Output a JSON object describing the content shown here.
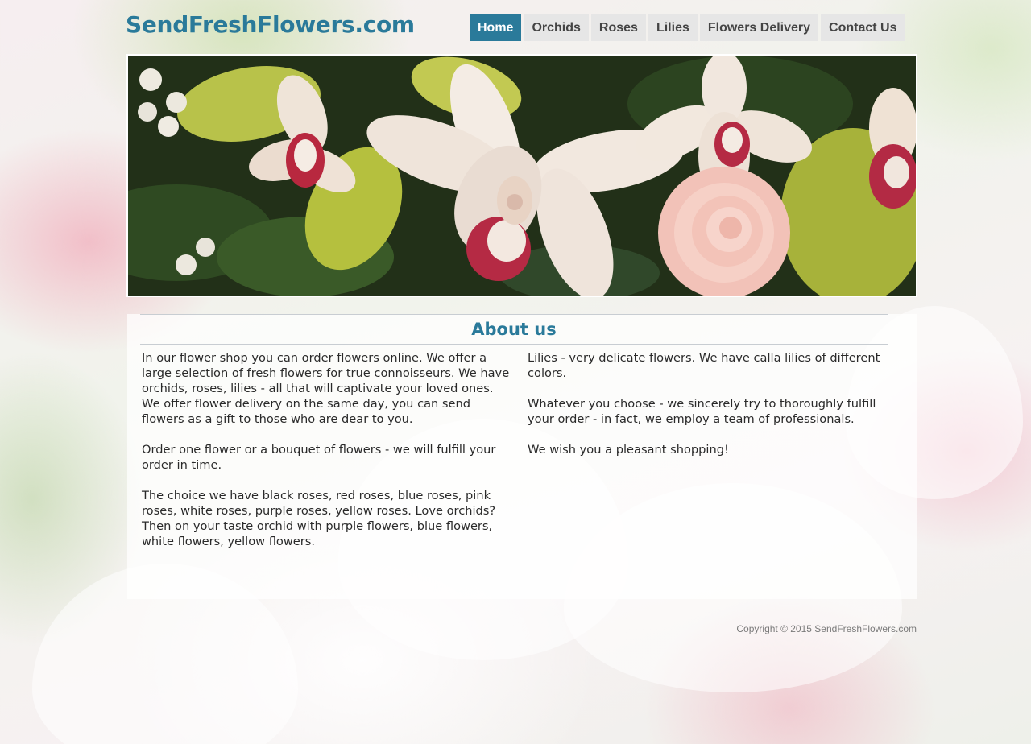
{
  "site": {
    "logo": "SendFreshFlowers.com"
  },
  "nav": {
    "items": [
      {
        "label": "Home"
      },
      {
        "label": "Orchids"
      },
      {
        "label": "Roses"
      },
      {
        "label": "Lilies"
      },
      {
        "label": "Flowers Delivery"
      },
      {
        "label": "Contact Us"
      }
    ],
    "active": "Home"
  },
  "about": {
    "heading": "About us",
    "left_paragraphs": [
      "In our flower shop you can order flowers online. We offer a large selection of fresh flowers for true connoisseurs. We have orchids, roses, lilies - all that will captivate your loved ones. We offer flower delivery on the same day, you can send flowers as a gift to those who are dear to you.",
      "Order one flower or a bouquet of flowers - we will fulfill your order in time.",
      "The choice we have black roses, red roses, blue roses, pink roses, white roses, purple roses, yellow roses. Love orchids? Then on your taste orchid with purple flowers, blue flowers, white flowers, yellow flowers."
    ],
    "right_paragraphs": [
      "Lilies - very delicate flowers. We have calla lilies of different colors.",
      "Whatever you choose - we sincerely try to thoroughly fulfill your order - in fact, we employ a team of professionals.",
      "We wish you a pleasant shopping!"
    ]
  },
  "footer": {
    "copyright": "Copyright © 2015 SendFreshFlowers.com"
  },
  "colors": {
    "brand": "#2a7a9a",
    "nav_bg": "#e6e6e6",
    "text": "#2a2a2a"
  }
}
